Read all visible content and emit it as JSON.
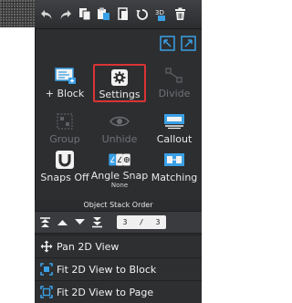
{
  "toolbar": {
    "icons": [
      "undo-icon",
      "redo-icon",
      "copy-icon",
      "paste-icon",
      "duplicate-icon",
      "reset-icon",
      "3d-icon",
      "delete-icon"
    ],
    "label_3d": "3D"
  },
  "panel": {
    "tiles": [
      {
        "name": "add-block-button",
        "label": "+ Block",
        "enabled": true,
        "selected": false,
        "icon": "add-block-icon"
      },
      {
        "name": "settings-button",
        "label": "Settings",
        "enabled": true,
        "selected": true,
        "icon": "gear-icon"
      },
      {
        "name": "divide-button",
        "label": "Divide",
        "enabled": false,
        "selected": false,
        "icon": "divide-icon"
      },
      {
        "name": "group-button",
        "label": "Group",
        "enabled": false,
        "selected": false,
        "icon": "group-icon"
      },
      {
        "name": "unhide-button",
        "label": "Unhide",
        "enabled": false,
        "selected": false,
        "icon": "eye-icon"
      },
      {
        "name": "callout-button",
        "label": "Callout",
        "enabled": true,
        "selected": false,
        "icon": "callout-icon"
      },
      {
        "name": "snaps-off-button",
        "label": "Snaps Off",
        "enabled": true,
        "selected": false,
        "icon": "magnet-icon"
      },
      {
        "name": "angle-snap-button",
        "label": "Angle Snap",
        "sub": "None",
        "enabled": true,
        "selected": false,
        "icon": "angle-snap-icon"
      },
      {
        "name": "matching-button",
        "label": "Matching",
        "enabled": true,
        "selected": false,
        "icon": "matching-icon"
      }
    ]
  },
  "stack_order": {
    "title": "Object Stack Order",
    "current": "3",
    "separator": "/",
    "total": "3"
  },
  "menu": [
    {
      "label": "Pan 2D View",
      "icon": "pan-icon"
    },
    {
      "label": "Fit 2D View to Block",
      "icon": "fit-block-icon"
    },
    {
      "label": "Fit 2D View to Page",
      "icon": "fit-page-icon"
    }
  ],
  "colors": {
    "accent": "#3aa0e6",
    "selection": "#d93434",
    "panel": "#2d2e30"
  }
}
